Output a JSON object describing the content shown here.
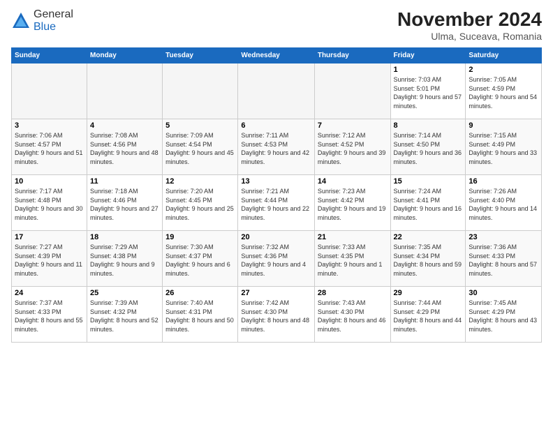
{
  "logo": {
    "general": "General",
    "blue": "Blue"
  },
  "title": "November 2024",
  "location": "Ulma, Suceava, Romania",
  "days_of_week": [
    "Sunday",
    "Monday",
    "Tuesday",
    "Wednesday",
    "Thursday",
    "Friday",
    "Saturday"
  ],
  "weeks": [
    [
      {
        "day": "",
        "info": ""
      },
      {
        "day": "",
        "info": ""
      },
      {
        "day": "",
        "info": ""
      },
      {
        "day": "",
        "info": ""
      },
      {
        "day": "",
        "info": ""
      },
      {
        "day": "1",
        "info": "Sunrise: 7:03 AM\nSunset: 5:01 PM\nDaylight: 9 hours and 57 minutes."
      },
      {
        "day": "2",
        "info": "Sunrise: 7:05 AM\nSunset: 4:59 PM\nDaylight: 9 hours and 54 minutes."
      }
    ],
    [
      {
        "day": "3",
        "info": "Sunrise: 7:06 AM\nSunset: 4:57 PM\nDaylight: 9 hours and 51 minutes."
      },
      {
        "day": "4",
        "info": "Sunrise: 7:08 AM\nSunset: 4:56 PM\nDaylight: 9 hours and 48 minutes."
      },
      {
        "day": "5",
        "info": "Sunrise: 7:09 AM\nSunset: 4:54 PM\nDaylight: 9 hours and 45 minutes."
      },
      {
        "day": "6",
        "info": "Sunrise: 7:11 AM\nSunset: 4:53 PM\nDaylight: 9 hours and 42 minutes."
      },
      {
        "day": "7",
        "info": "Sunrise: 7:12 AM\nSunset: 4:52 PM\nDaylight: 9 hours and 39 minutes."
      },
      {
        "day": "8",
        "info": "Sunrise: 7:14 AM\nSunset: 4:50 PM\nDaylight: 9 hours and 36 minutes."
      },
      {
        "day": "9",
        "info": "Sunrise: 7:15 AM\nSunset: 4:49 PM\nDaylight: 9 hours and 33 minutes."
      }
    ],
    [
      {
        "day": "10",
        "info": "Sunrise: 7:17 AM\nSunset: 4:48 PM\nDaylight: 9 hours and 30 minutes."
      },
      {
        "day": "11",
        "info": "Sunrise: 7:18 AM\nSunset: 4:46 PM\nDaylight: 9 hours and 27 minutes."
      },
      {
        "day": "12",
        "info": "Sunrise: 7:20 AM\nSunset: 4:45 PM\nDaylight: 9 hours and 25 minutes."
      },
      {
        "day": "13",
        "info": "Sunrise: 7:21 AM\nSunset: 4:44 PM\nDaylight: 9 hours and 22 minutes."
      },
      {
        "day": "14",
        "info": "Sunrise: 7:23 AM\nSunset: 4:42 PM\nDaylight: 9 hours and 19 minutes."
      },
      {
        "day": "15",
        "info": "Sunrise: 7:24 AM\nSunset: 4:41 PM\nDaylight: 9 hours and 16 minutes."
      },
      {
        "day": "16",
        "info": "Sunrise: 7:26 AM\nSunset: 4:40 PM\nDaylight: 9 hours and 14 minutes."
      }
    ],
    [
      {
        "day": "17",
        "info": "Sunrise: 7:27 AM\nSunset: 4:39 PM\nDaylight: 9 hours and 11 minutes."
      },
      {
        "day": "18",
        "info": "Sunrise: 7:29 AM\nSunset: 4:38 PM\nDaylight: 9 hours and 9 minutes."
      },
      {
        "day": "19",
        "info": "Sunrise: 7:30 AM\nSunset: 4:37 PM\nDaylight: 9 hours and 6 minutes."
      },
      {
        "day": "20",
        "info": "Sunrise: 7:32 AM\nSunset: 4:36 PM\nDaylight: 9 hours and 4 minutes."
      },
      {
        "day": "21",
        "info": "Sunrise: 7:33 AM\nSunset: 4:35 PM\nDaylight: 9 hours and 1 minute."
      },
      {
        "day": "22",
        "info": "Sunrise: 7:35 AM\nSunset: 4:34 PM\nDaylight: 8 hours and 59 minutes."
      },
      {
        "day": "23",
        "info": "Sunrise: 7:36 AM\nSunset: 4:33 PM\nDaylight: 8 hours and 57 minutes."
      }
    ],
    [
      {
        "day": "24",
        "info": "Sunrise: 7:37 AM\nSunset: 4:33 PM\nDaylight: 8 hours and 55 minutes."
      },
      {
        "day": "25",
        "info": "Sunrise: 7:39 AM\nSunset: 4:32 PM\nDaylight: 8 hours and 52 minutes."
      },
      {
        "day": "26",
        "info": "Sunrise: 7:40 AM\nSunset: 4:31 PM\nDaylight: 8 hours and 50 minutes."
      },
      {
        "day": "27",
        "info": "Sunrise: 7:42 AM\nSunset: 4:30 PM\nDaylight: 8 hours and 48 minutes."
      },
      {
        "day": "28",
        "info": "Sunrise: 7:43 AM\nSunset: 4:30 PM\nDaylight: 8 hours and 46 minutes."
      },
      {
        "day": "29",
        "info": "Sunrise: 7:44 AM\nSunset: 4:29 PM\nDaylight: 8 hours and 44 minutes."
      },
      {
        "day": "30",
        "info": "Sunrise: 7:45 AM\nSunset: 4:29 PM\nDaylight: 8 hours and 43 minutes."
      }
    ]
  ]
}
